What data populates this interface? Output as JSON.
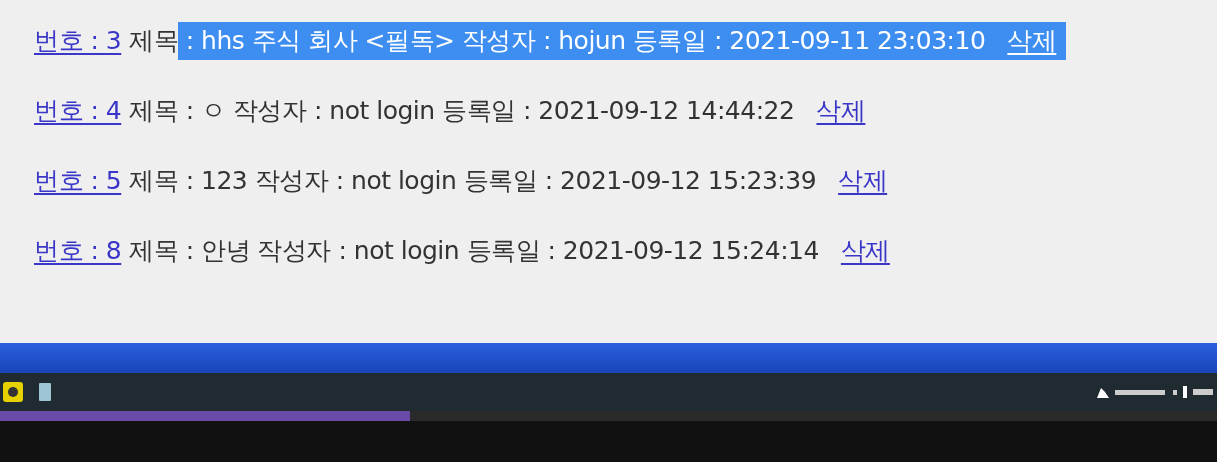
{
  "posts": [
    {
      "number_link": "번호 : 3",
      "title_label": "제목",
      "details": " : hhs 주식 회사 <필독> 작성자 : hojun 등록일 : 2021-09-11 23:03:10",
      "delete_link": "삭제",
      "highlighted": true
    },
    {
      "number_link": "번호 : 4",
      "title_label": "제목",
      "details": " : ㅇ 작성자 : not login 등록일 : 2021-09-12 14:44:22",
      "delete_link": "삭제",
      "highlighted": false
    },
    {
      "number_link": "번호 : 5",
      "title_label": "제목",
      "details": " : 123 작성자 : not login 등록일 : 2021-09-12 15:23:39",
      "delete_link": "삭제",
      "highlighted": false
    },
    {
      "number_link": "번호 : 8",
      "title_label": "제목",
      "details": " : 안녕 작성자 : not login 등록일 : 2021-09-12 15:24:14",
      "delete_link": "삭제",
      "highlighted": false
    }
  ],
  "video_progress": {
    "level": 0.337
  }
}
